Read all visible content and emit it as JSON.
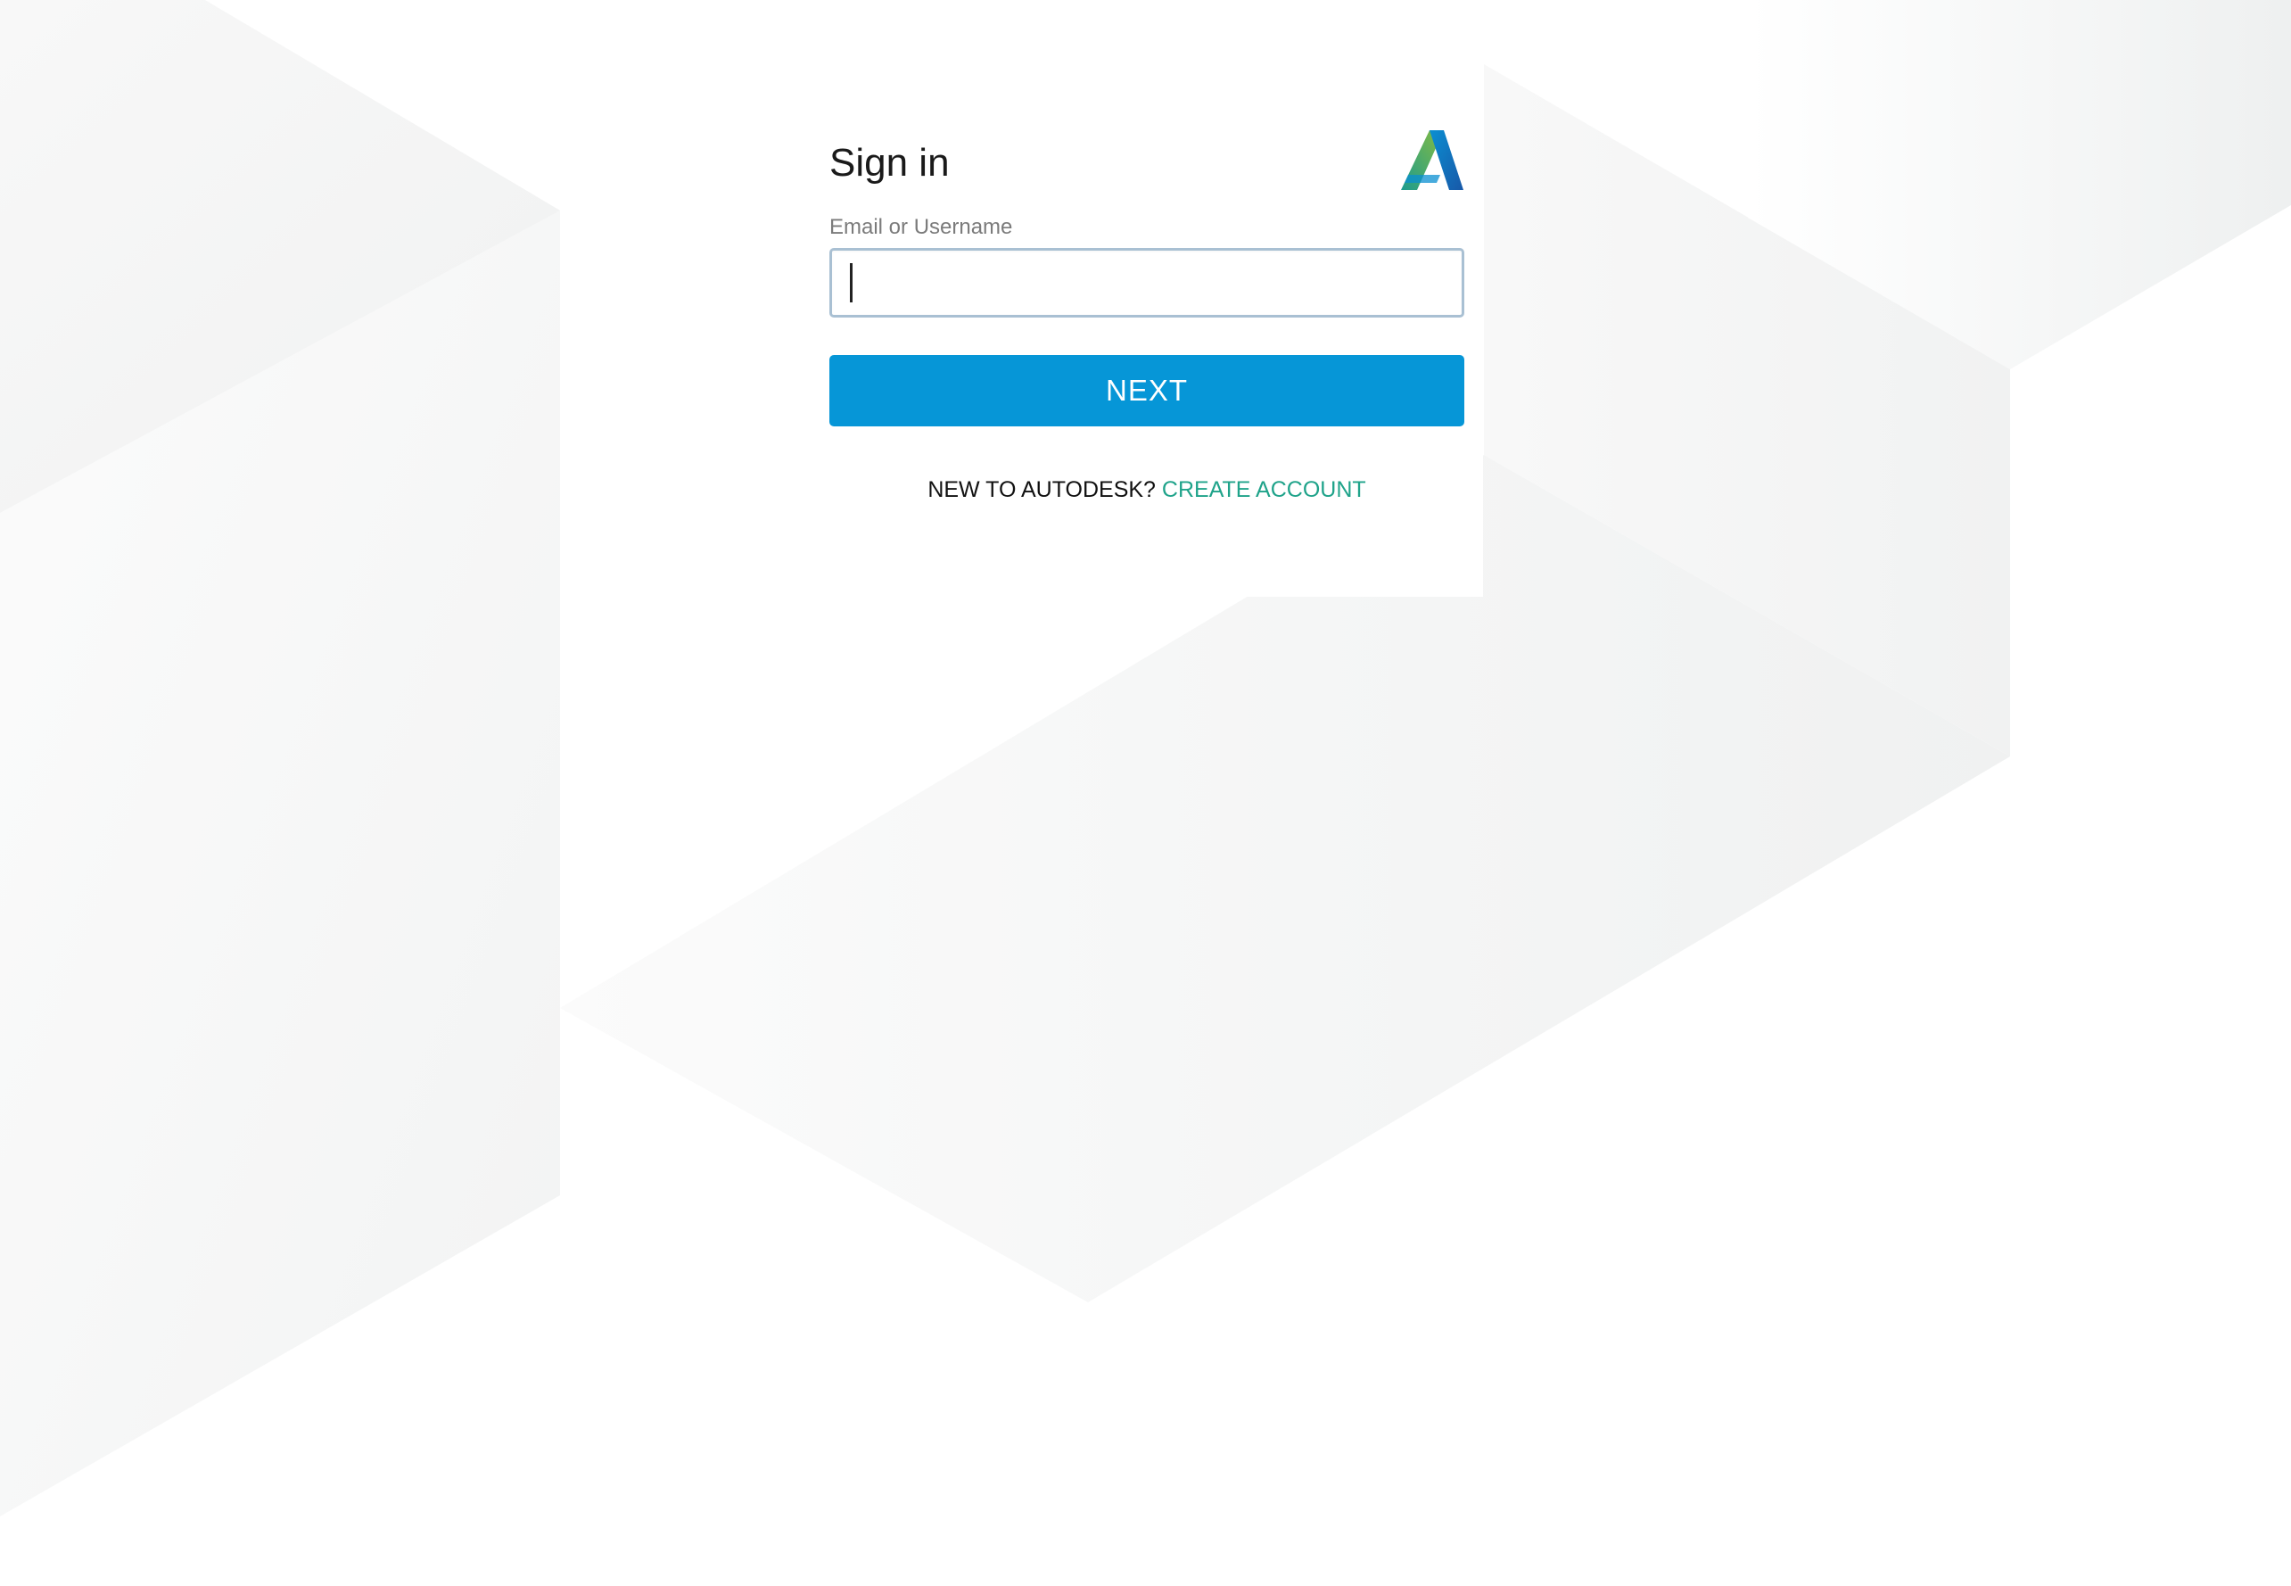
{
  "signin": {
    "title": "Sign in",
    "email_label": "Email or Username",
    "email_value": "",
    "email_placeholder": "",
    "next_label": "NEXT",
    "new_user_text": "NEW TO AUTODESK?",
    "create_account_label": "CREATE ACCOUNT"
  },
  "brand": {
    "logo_icon": "autodesk-logo-icon",
    "logo_colors": [
      "#87bc40",
      "#1c9b8e",
      "#0696d7",
      "#1858a8"
    ]
  },
  "colors": {
    "button": "#0696d7",
    "link": "#1fa38a",
    "input_border": "#a9c0d3",
    "background_shapes": "#f1f2f2"
  }
}
